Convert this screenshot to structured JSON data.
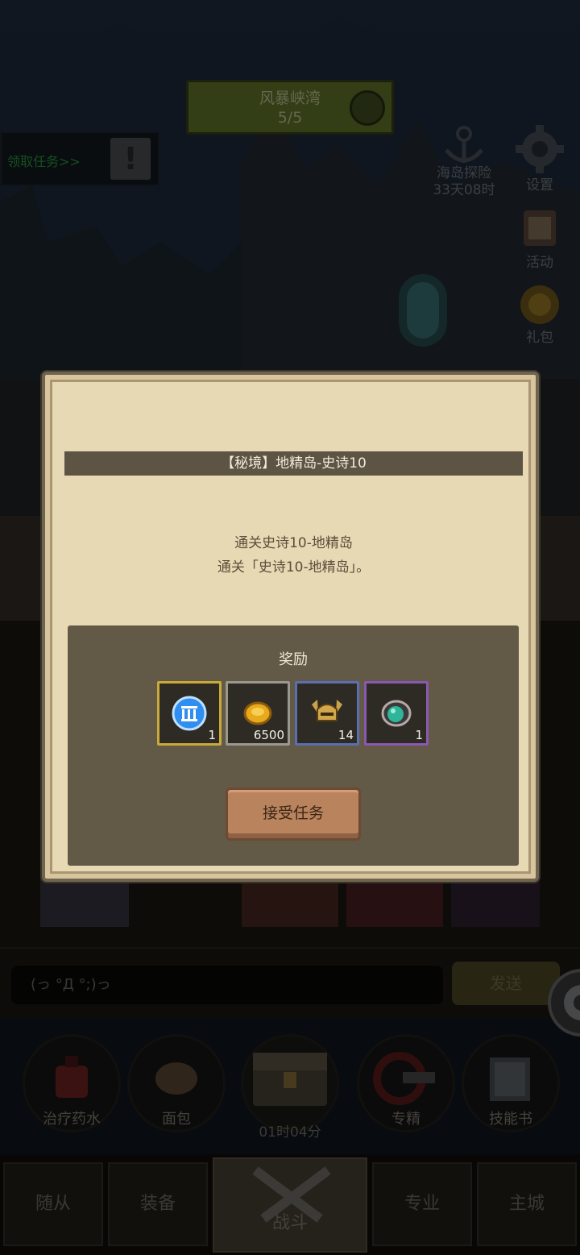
{
  "hud": {
    "location_name": "风暴峡湾",
    "location_progress": "5/5",
    "quest_tab_label": "领取任务>>",
    "quest_alert": "!",
    "island_label": "海岛探险",
    "island_timer": "33天08时",
    "settings_label": "设置",
    "activity_label": "活动",
    "gift_label": "礼包"
  },
  "modal": {
    "title": "【秘境】地精岛-史诗10",
    "desc_line1": "通关史诗10-地精岛",
    "desc_line2": "通关「史诗10-地精岛」。",
    "reward_title": "奖励",
    "rewards": [
      {
        "icon": "blue-pillar-token-icon",
        "qty": "1",
        "border": "#c9a93a"
      },
      {
        "icon": "gold-coin-icon",
        "qty": "6500",
        "border": "#9a978e"
      },
      {
        "icon": "horned-helmet-icon",
        "qty": "14",
        "border": "#5b6fb0"
      },
      {
        "icon": "green-gem-icon",
        "qty": "1",
        "border": "#8a58b0"
      }
    ],
    "accept_label": "接受任务"
  },
  "chat": {
    "input_value": "(っ °Д °;)っ",
    "send_label": "发送"
  },
  "items": [
    {
      "label": "治疗药水",
      "icon": "potion-icon"
    },
    {
      "label": "面包",
      "icon": "bread-icon"
    },
    {
      "label": "",
      "icon": "chest-icon"
    },
    {
      "label": "专精",
      "icon": "specialty-icon"
    },
    {
      "label": "技能书",
      "icon": "skill-book-icon"
    }
  ],
  "chest_timer": "01时04分",
  "tabs": [
    "随从",
    "装备",
    "战斗",
    "专业",
    "主城"
  ]
}
